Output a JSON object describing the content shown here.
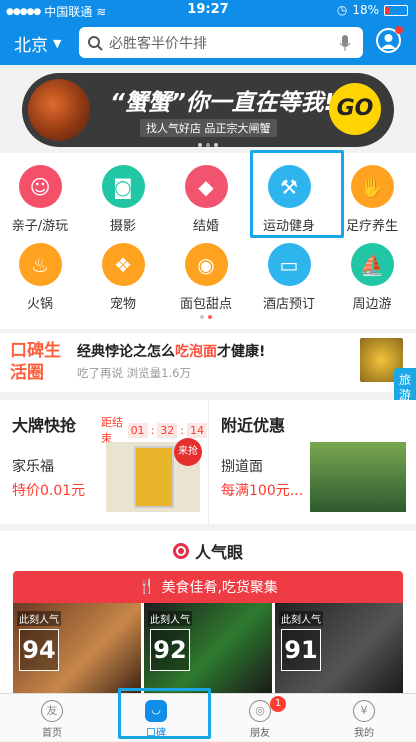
{
  "status": {
    "carrier": "中国联通",
    "time": "19:27",
    "battery": "18%"
  },
  "nav": {
    "city": "北京",
    "search_placeholder": "必胜客半价牛排"
  },
  "banner": {
    "title": "“蟹蟹”你一直在等我!",
    "subtitle": "找人气好店 品正宗大闸蟹",
    "cta": "GO"
  },
  "categories": [
    {
      "label": "亲子/游玩",
      "color": "#f4506a",
      "icon": "baby-icon"
    },
    {
      "label": "摄影",
      "color": "#21c7a4",
      "icon": "camera-icon"
    },
    {
      "label": "结婚",
      "color": "#f25470",
      "icon": "diamond-icon"
    },
    {
      "label": "运动健身",
      "color": "#2fb5ee",
      "icon": "dumbbell-icon"
    },
    {
      "label": "足疗养生",
      "color": "#ffa21f",
      "icon": "foot-icon"
    },
    {
      "label": "火锅",
      "color": "#ffa21f",
      "icon": "hotpot-icon"
    },
    {
      "label": "宠物",
      "color": "#ffa21f",
      "icon": "dog-icon"
    },
    {
      "label": "面包甜点",
      "color": "#ffa21f",
      "icon": "donut-icon"
    },
    {
      "label": "酒店预订",
      "color": "#2fb5ee",
      "icon": "bed-icon"
    },
    {
      "label": "周边游",
      "color": "#21c7a4",
      "icon": "sailboat-icon"
    }
  ],
  "koubei": {
    "logo": "口碑生活圈",
    "title_a": "经典悖论之怎么",
    "title_hl": "吃泡面",
    "title_b": "才健康!",
    "meta": "吃了再说  浏览量1.6万"
  },
  "travel_tab": "旅游版",
  "deals": {
    "left_title": "大牌快抢",
    "countdown_label": "距结束",
    "countdown": [
      "01",
      "32",
      "14"
    ],
    "left_shop": "家乐福",
    "left_price": "特价0.01元",
    "left_tag": "来抢",
    "right_title": "附近优惠",
    "right_shop": "捌道面",
    "right_price": "每满100元..."
  },
  "popular": {
    "title": "人气眼",
    "bar_text": "美食佳肴,吃货聚集",
    "cards": [
      {
        "label": "此刻人气",
        "score": "94"
      },
      {
        "label": "此刻人气",
        "score": "92"
      },
      {
        "label": "此刻人气",
        "score": "91"
      }
    ]
  },
  "tabs": [
    {
      "label": "首页",
      "icon": "home-icon"
    },
    {
      "label": "口碑",
      "icon": "koubei-icon"
    },
    {
      "label": "朋友",
      "icon": "friends-icon",
      "badge": "1"
    },
    {
      "label": "我的",
      "icon": "wallet-icon"
    }
  ]
}
